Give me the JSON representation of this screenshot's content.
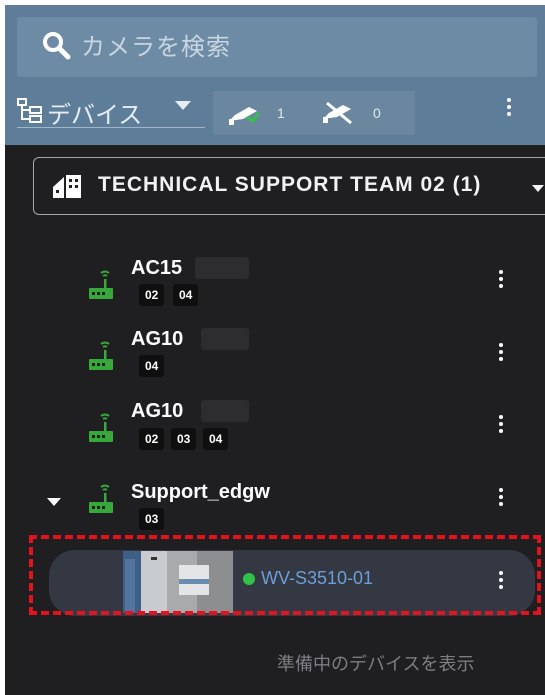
{
  "search": {
    "placeholder": "カメラを検索"
  },
  "toolbar": {
    "device_label": "デバイス",
    "online_count": "1",
    "offline_count": "0"
  },
  "team": {
    "label": "TECHNICAL SUPPORT TEAM 02 (1)"
  },
  "gateways": [
    {
      "name": "AC15",
      "chips": [
        "02",
        "04"
      ]
    },
    {
      "name": "AG10",
      "chips": [
        "04"
      ]
    },
    {
      "name": "AG10",
      "chips": [
        "02",
        "03",
        "04"
      ]
    },
    {
      "name": "Support_edgw",
      "chips": [
        "03"
      ]
    }
  ],
  "camera": {
    "name": "WV-S3510-01",
    "status_color": "#32c24a"
  },
  "footer": {
    "show_pending_label": "準備中のデバイスを表示"
  },
  "colors": {
    "header": "#5d7d98",
    "panel": "#1f1f21",
    "accent_green": "#37a83a",
    "highlight": "#e4121d"
  }
}
